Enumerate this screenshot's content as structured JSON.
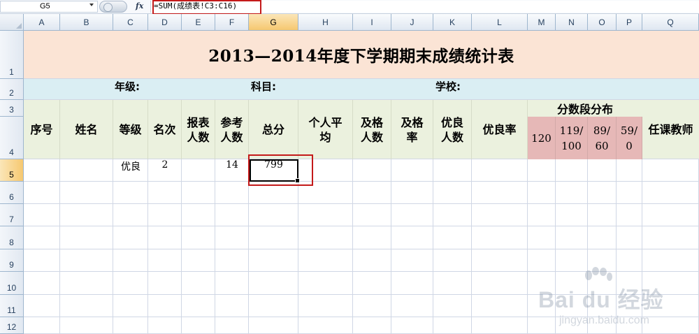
{
  "formula_bar": {
    "name_box": "G5",
    "fx_label": "fx",
    "formula": "=SUM(成绩表!C3:C16)"
  },
  "columns": [
    "A",
    "B",
    "C",
    "D",
    "E",
    "F",
    "G",
    "H",
    "I",
    "J",
    "K",
    "L",
    "M",
    "N",
    "O",
    "P",
    "Q"
  ],
  "rows": [
    "1",
    "2",
    "3",
    "4",
    "5",
    "6",
    "7",
    "8",
    "9",
    "10",
    "11",
    "12"
  ],
  "selected_cell": "G5",
  "sheet": {
    "title": "2013—2014年度下学期期末成绩统计表",
    "row2": {
      "grade_label": "年级:",
      "subject_label": "科目:",
      "school_label": "学校:"
    },
    "headers": {
      "seq": "序号",
      "name": "姓名",
      "level": "等级",
      "rank": "名次",
      "reported_1": "报表",
      "reported_2": "人数",
      "exam_1": "参考",
      "exam_2": "人数",
      "total": "总分",
      "avg_1": "个人平",
      "avg_2": "均",
      "pass_n_1": "及格",
      "pass_n_2": "人数",
      "pass_r_1": "及格",
      "pass_r_2": "率",
      "good_n_1": "优良",
      "good_n_2": "人数",
      "good_rate": "优良率",
      "dist_title": "分数段分布",
      "d1": "120",
      "d2_1": "119/",
      "d2_2": "100",
      "d3_1": "89/",
      "d3_2": "60",
      "d4_1": "59/",
      "d4_2": "0",
      "teacher": "任课教师"
    },
    "row5": {
      "level": "优良",
      "rank": "2",
      "exam_count": "14",
      "total": "799"
    }
  },
  "watermark": {
    "brand": "Bai du 经验",
    "url": "jingyan.baidu.com"
  },
  "colors": {
    "title_bg": "#fbe4d5",
    "row2_bg": "#daeef3",
    "header_bg": "#ebf1de",
    "dist_bg": "#e6b8b7",
    "highlight": "#c41a1a"
  }
}
